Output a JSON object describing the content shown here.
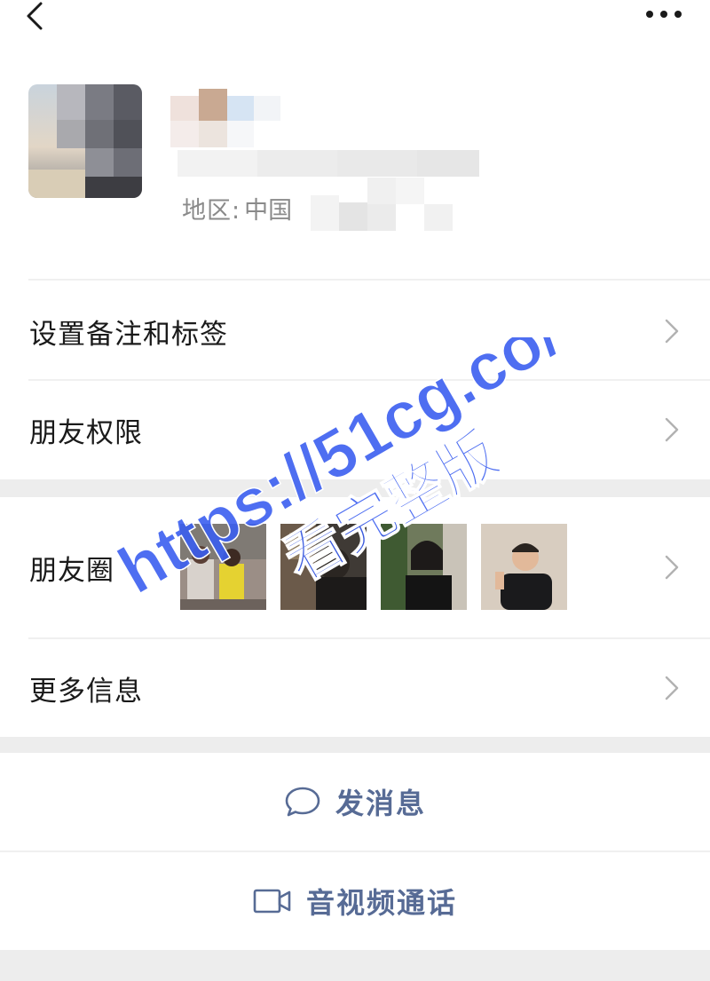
{
  "topbar": {
    "back_icon": "chevron-left-icon",
    "more_icon": "more-dots-icon"
  },
  "profile": {
    "region_label": "地区:",
    "region_value": "中国"
  },
  "menu": {
    "remark_label": "设置备注和标签",
    "permissions_label": "朋友权限",
    "moments_label": "朋友圈",
    "more_info_label": "更多信息"
  },
  "actions": {
    "message_label": "发消息",
    "call_label": "音视频通话"
  },
  "watermark": {
    "line1": "https://51cg.co/",
    "line2": "看完整版"
  },
  "colors": {
    "link": "#576b95",
    "gap": "#ededed",
    "watermark": "#3b5ef0"
  }
}
